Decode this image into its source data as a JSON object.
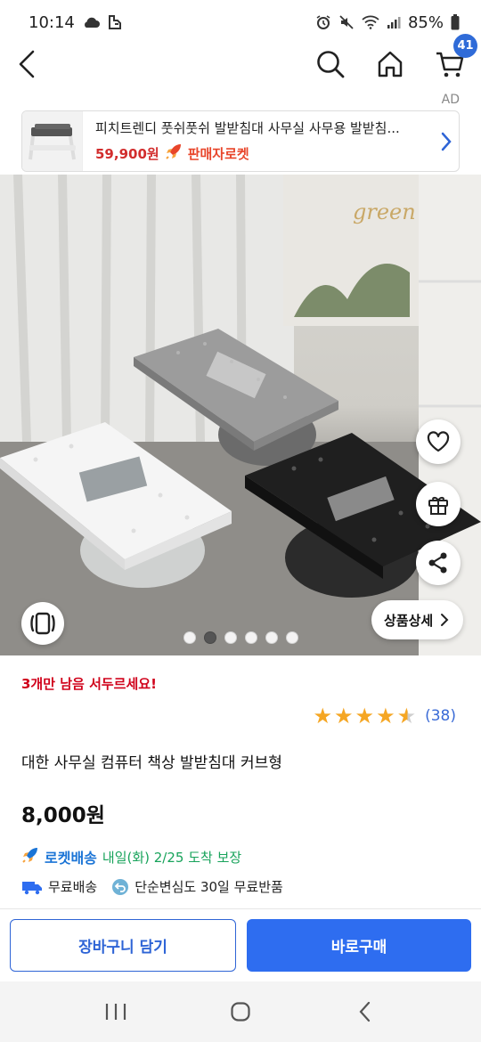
{
  "status_bar": {
    "time": "10:14",
    "battery": "85%"
  },
  "nav": {
    "cart_count": "41"
  },
  "ad": {
    "label": "AD",
    "title": "피치트렌디 풋쉬풋쉬 발받침대 사무실 사무용 발받침...",
    "price": "59,900원",
    "rocket_label": "판매자로켓"
  },
  "gallery": {
    "detail_button": "상품상세",
    "dot_count": 6,
    "active_index": 1,
    "image_text": "green mood"
  },
  "product": {
    "stock_warning": "3개만 남음 서두르세요!",
    "rating": 4.5,
    "review_count": "(38)",
    "title": "대한 사무실 컴퓨터 책상 발받침대 커브형",
    "price": "8,000원",
    "delivery_label": "로켓배송",
    "delivery_text": "내일(화) 2/25 도착 보장",
    "perk_free_shipping": "무료배송",
    "perk_returns": "단순변심도 30일 무료반품"
  },
  "actions": {
    "cart_button": "장바구니 담기",
    "buy_button": "바로구매"
  },
  "colors": {
    "accent_blue": "#2e6df0",
    "stock_red": "#d0021b",
    "delivery_green": "#18a35b",
    "star": "#f5a623"
  }
}
